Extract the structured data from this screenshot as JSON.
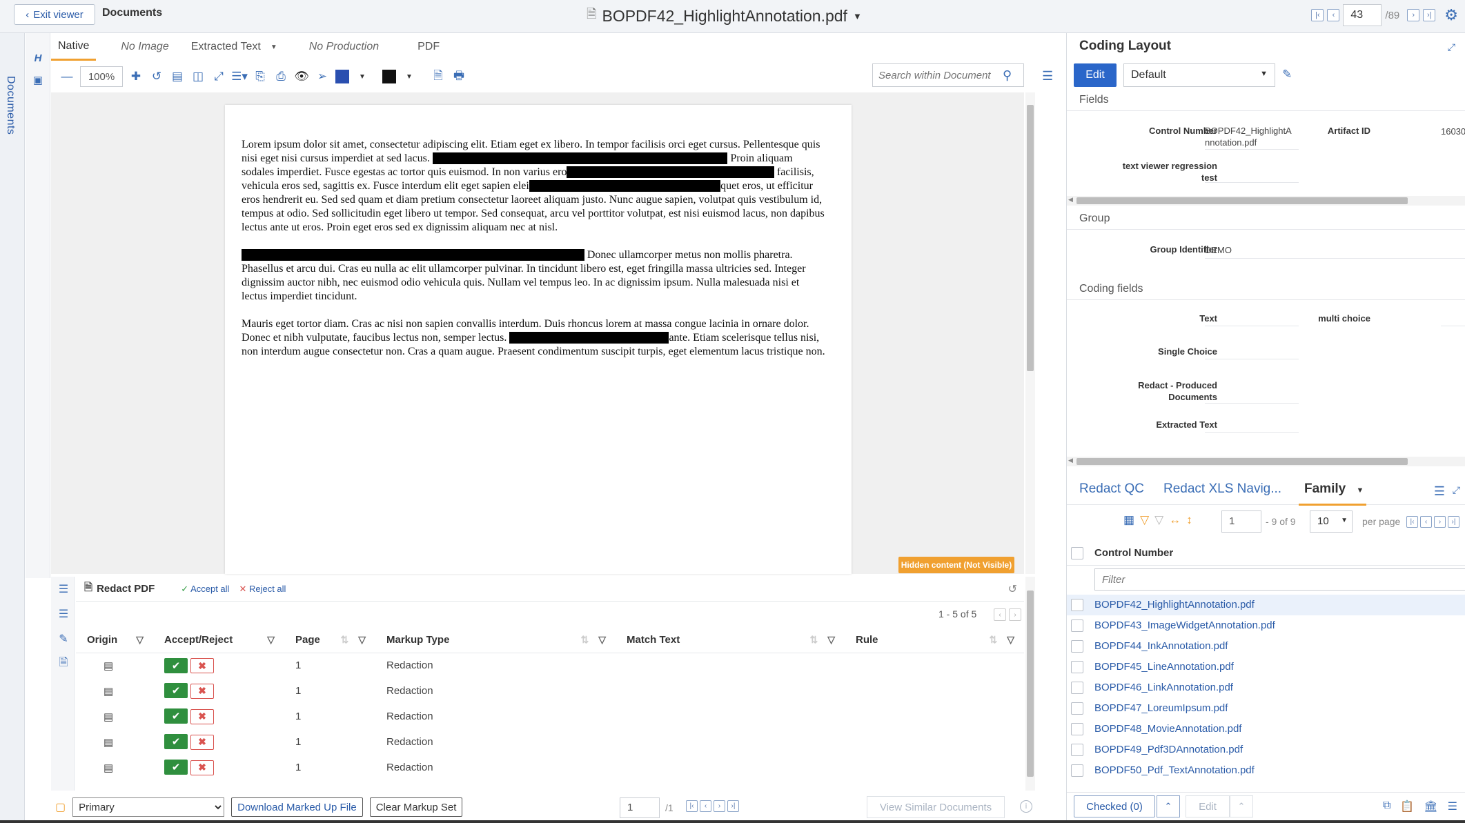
{
  "topbar": {
    "exit_label": "Exit viewer",
    "crumb": "Documents",
    "doc_title": "BOPDF42_HighlightAnnotation.pdf",
    "page_current": "43",
    "page_total": "/89"
  },
  "left_rail": {
    "label": "Documents"
  },
  "viewer_tabs": [
    {
      "label": "Native"
    },
    {
      "label": "No Image"
    },
    {
      "label": "Extracted Text"
    },
    {
      "label": "No Production"
    },
    {
      "label": "PDF"
    }
  ],
  "toolbar": {
    "zoom": "100%",
    "search_placeholder": "Search within Document",
    "color_fill": "#2a4fb0",
    "color_stroke": "#111111"
  },
  "document": {
    "p1": [
      "Lorem ipsum dolor sit amet, consectetur adipiscing elit. Etiam eget ex libero. In tempor facilisis orci eget cursus. Pellentesque quis nisi eget nisi cursus imperdiet at sed lacus. ",
      "XXXXXXXXXXXXXXXXXXXXXXXXXXXXXXXXXXXXX",
      " Proin aliquam sodales imperdiet. Fusce egestas ac tortor quis euismod. In non varius ero",
      "XXXXXXXXXXXXXXXXXXXXXXXXXX",
      " facilisis, vehicula eros sed, sagittis ex. Fusce interdum elit eget sapien elei",
      "XXXXXXXXXXXXXXXXXXXXXXXX",
      "quet eros, ut efficitur eros hendrerit eu. Sed sed quam et diam pretium consectetur laoreet aliquam justo. Nunc augue sapien, volutpat quis vestibulum id, tempus at odio. Sed sollicitudin eget libero ut tempor. Sed consequat, arcu vel porttitor volutpat, est nisi euismod lacus, non dapibus lectus ante ut eros. Proin eget eros sed ex dignissim aliquam nec at nisl."
    ],
    "p2": [
      "XXXXXXXXXXXXXXXXXXXXXXXXXXXXXXXXXXXXXXXXXXX",
      " Donec ullamcorper metus non mollis pharetra. Phasellus et arcu dui. Cras eu nulla ac elit ullamcorper pulvinar. In tincidunt libero est, eget fringilla massa ultricies sed. Integer dignissim auctor nibh, nec euismod odio vehicula quis. Nullam vel tempus leo. In ac dignissim ipsum. Nulla malesuada nisi et lectus imperdiet tincidunt."
    ],
    "p3": [
      "Mauris eget tortor diam. Cras ac nisi non sapien convallis interdum. Duis rhoncus lorem at massa congue lacinia in ornare dolor. Donec et nibh vulputate, faucibus lectus non, semper lectus. ",
      "XXXXXXXXXXXXXXXXXXXX",
      "ante. Etiam scelerisque tellus nisi, non interdum augue consectetur non. Cras a quam augue. Praesent condimentum suscipit turpis, eget elementum lacus tristique non."
    ],
    "hidden_badge": "Hidden content (Not Visible)"
  },
  "markup": {
    "title": "Redact PDF",
    "accept_all": "Accept all",
    "reject_all": "Reject all",
    "count": "1 - 5 of 5",
    "columns": [
      "Origin",
      "Accept/Reject",
      "Page",
      "Markup Type",
      "Match Text",
      "Rule"
    ],
    "rows": [
      {
        "page": "1",
        "type": "Redaction"
      },
      {
        "page": "1",
        "type": "Redaction"
      },
      {
        "page": "1",
        "type": "Redaction"
      },
      {
        "page": "1",
        "type": "Redaction"
      },
      {
        "page": "1",
        "type": "Redaction"
      }
    ]
  },
  "bottombar": {
    "markup_set": "Primary",
    "download_label": "Download Marked Up File",
    "clear_label": "Clear Markup Set",
    "page": "1",
    "page_total": "/1",
    "similar_label": "View Similar Documents"
  },
  "coding": {
    "title": "Coding Layout",
    "edit_label": "Edit",
    "layout_value": "Default",
    "fields_section": "Fields",
    "control_number_label": "Control Number",
    "control_number_value_1": "BOPDF42_HighlightA",
    "control_number_value_2": "nnotation.pdf",
    "artifact_label": "Artifact ID",
    "artifact_value": "16030",
    "regression_label_1": "text viewer regression",
    "regression_label_2": "test",
    "group_section": "Group",
    "group_id_label": "Group Identifier",
    "group_id_value": "DEMO",
    "coding_section": "Coding fields",
    "text_label": "Text",
    "multi_label": "multi choice",
    "single_label": "Single Choice",
    "redact_label_1": "Redact - Produced",
    "redact_label_2": "Documents",
    "extracted_label": "Extracted Text"
  },
  "family": {
    "tabs": [
      "Redact QC",
      "Redact XLS Navig...",
      "Family"
    ],
    "page": "1",
    "of": "- 9 of 9",
    "per_page_value": "10",
    "per_page_label": "per page",
    "column": "Control Number",
    "filter_placeholder": "Filter",
    "items": [
      "BOPDF42_HighlightAnnotation.pdf",
      "BOPDF43_ImageWidgetAnnotation.pdf",
      "BOPDF44_InkAnnotation.pdf",
      "BOPDF45_LineAnnotation.pdf",
      "BOPDF46_LinkAnnotation.pdf",
      "BOPDF47_LoreumIpsum.pdf",
      "BOPDF48_MovieAnnotation.pdf",
      "BOPDF49_Pdf3DAnnotation.pdf",
      "BOPDF50_Pdf_TextAnnotation.pdf"
    ],
    "checked_label": "Checked (0)",
    "edit_label": "Edit"
  }
}
